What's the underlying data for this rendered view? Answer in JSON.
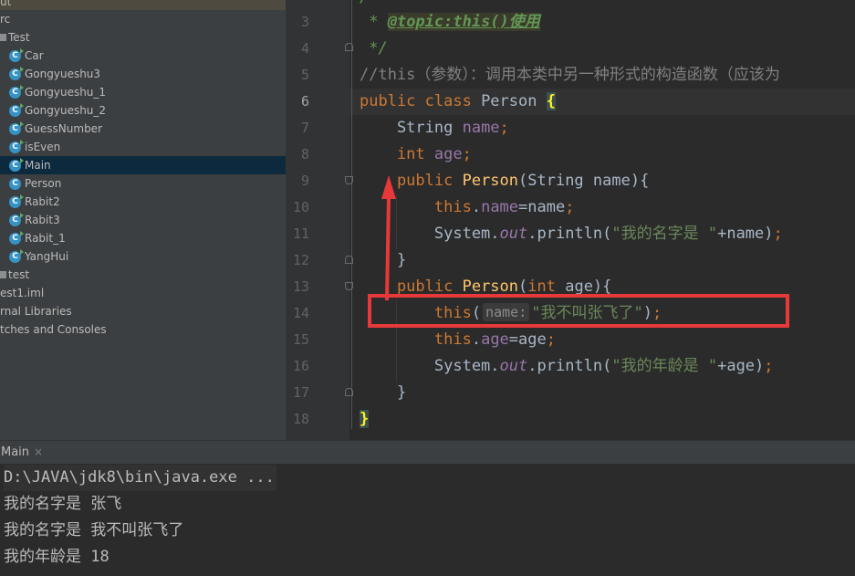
{
  "project": {
    "top_clip": "ut",
    "items": [
      {
        "label": "rc",
        "kind": "folder-clip"
      },
      {
        "label": "Test",
        "kind": "package"
      },
      {
        "label": "Car",
        "kind": "class-run"
      },
      {
        "label": "Gongyueshu3",
        "kind": "class-run"
      },
      {
        "label": "Gongyueshu_1",
        "kind": "class-run"
      },
      {
        "label": "Gongyueshu_2",
        "kind": "class-run"
      },
      {
        "label": "GuessNumber",
        "kind": "class-run"
      },
      {
        "label": "isEven",
        "kind": "class-run"
      },
      {
        "label": "Main",
        "kind": "class-run",
        "selected": true
      },
      {
        "label": "Person",
        "kind": "class"
      },
      {
        "label": "Rabit2",
        "kind": "class-run"
      },
      {
        "label": "Rabit3",
        "kind": "class-run"
      },
      {
        "label": "Rabit_1",
        "kind": "class-run"
      },
      {
        "label": "YangHui",
        "kind": "class-run"
      },
      {
        "label": "test",
        "kind": "package-run"
      },
      {
        "label": "est1.iml",
        "kind": "file"
      },
      {
        "label": "rnal Libraries",
        "kind": "lib"
      },
      {
        "label": "tches and Consoles",
        "kind": "scratch"
      }
    ]
  },
  "editor": {
    "current_line": "6",
    "line_numbers": [
      "3",
      "4",
      "5",
      "6",
      "7",
      "8",
      "9",
      "10",
      "11",
      "12",
      "13",
      "14",
      "15",
      "16",
      "17",
      "18"
    ],
    "code": {
      "l2": "/",
      "l3_star": " * ",
      "l3_tag": "@topic:this()使用",
      "l4": " */",
      "l5": "//this（参数）：调用本类中另一种形式的构造函数（应该为",
      "l6_kw": "public class ",
      "l6_name": "Person ",
      "l6_brace": "{",
      "l7_type": "    String ",
      "l7_field": "name",
      "l7_semi": ";",
      "l8_kw": "    int ",
      "l8_field": "age",
      "l8_semi": ";",
      "l9_kw": "    public ",
      "l9_fn": "Person",
      "l9_rest": "(String name){",
      "l10_kw": "        this",
      "l10_dot": ".",
      "l10_field": "name",
      "l10_rest": "=name",
      "l10_semi": ";",
      "l11_pre": "        System.",
      "l11_out": "out",
      "l11_mid": ".println(",
      "l11_str": "\"我的名字是 \"",
      "l11_post": "+name)",
      "l11_semi": ";",
      "l12": "    }",
      "l13_kw": "    public ",
      "l13_fn": "Person",
      "l13_p": "(",
      "l13_kw2": "int",
      "l13_rest": " age){",
      "l14_kw": "        this",
      "l14_p": "(",
      "l14_hint": "name:",
      "l14_str": "\"我不叫张飞了\"",
      "l14_end": ")",
      "l14_semi": ";",
      "l15_kw": "        this",
      "l15_dot": ".",
      "l15_field": "age",
      "l15_rest": "=age",
      "l15_semi": ";",
      "l16_pre": "        System.",
      "l16_out": "out",
      "l16_mid": ".println(",
      "l16_str": "\"我的年龄是 \"",
      "l16_post": "+age)",
      "l16_semi": ";",
      "l17": "    }",
      "l18": "}"
    }
  },
  "run": {
    "tab_label": "Main",
    "tab_close": "×",
    "output": [
      "D:\\JAVA\\jdk8\\bin\\java.exe ...",
      "我的名字是 张飞",
      "我的名字是 我不叫张飞了",
      "我的年龄是 18"
    ]
  },
  "colors": {
    "keyword": "#cc7832",
    "field": "#9876aa",
    "string": "#6a8759",
    "method": "#ffc66d",
    "annotation_box": "#e8393a",
    "selection": "#0d293e"
  }
}
